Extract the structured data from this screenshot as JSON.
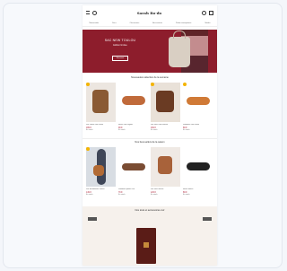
{
  "store": {
    "logo": "Sarah Bo·do"
  },
  "nav": [
    "Nouveautés",
    "Sacs",
    "Chaussures",
    "Accessoires",
    "Petite maroquinerie",
    "Soldes"
  ],
  "hero": {
    "headline": "SAC NEW TOULOU",
    "subhead": "Édition limitée",
    "cta": "Découvrir"
  },
  "section1": {
    "title": "Nouveautés sélection de la semaine",
    "products": [
      {
        "name": "Sac cabas cuir camel",
        "price": "189 €",
        "stock": "En stock",
        "badge": "#f4b400"
      },
      {
        "name": "Mules cuir cognac",
        "price": "99 €",
        "stock": "En stock",
        "badge": ""
      },
      {
        "name": "Sac seau cuir marron",
        "price": "169 €",
        "stock": "En stock",
        "badge": "#f4b400"
      },
      {
        "name": "Sandales cuir camel",
        "price": "89 €",
        "stock": "En stock",
        "badge": "#f4b400"
      }
    ]
  },
  "section2": {
    "title": "Nos best-sellers de la saison",
    "products": [
      {
        "name": "Sac bandoulière camel",
        "price": "149 €",
        "stock": "En stock",
        "badge": "#f4b400"
      },
      {
        "name": "Sandales plates cuir",
        "price": "79 €",
        "stock": "En stock",
        "badge": ""
      },
      {
        "name": "Sac seau tressé",
        "price": "129 €",
        "stock": "En stock",
        "badge": ""
      },
      {
        "name": "Mules noires",
        "price": "89 €",
        "stock": "En stock",
        "badge": ""
      }
    ]
  },
  "bottom": {
    "title": "Nos étuis et accessoires cuir",
    "left_tag": "",
    "right_tag": ""
  },
  "colors": {
    "hero": "#8d1d2c",
    "price": "#b1243a"
  }
}
